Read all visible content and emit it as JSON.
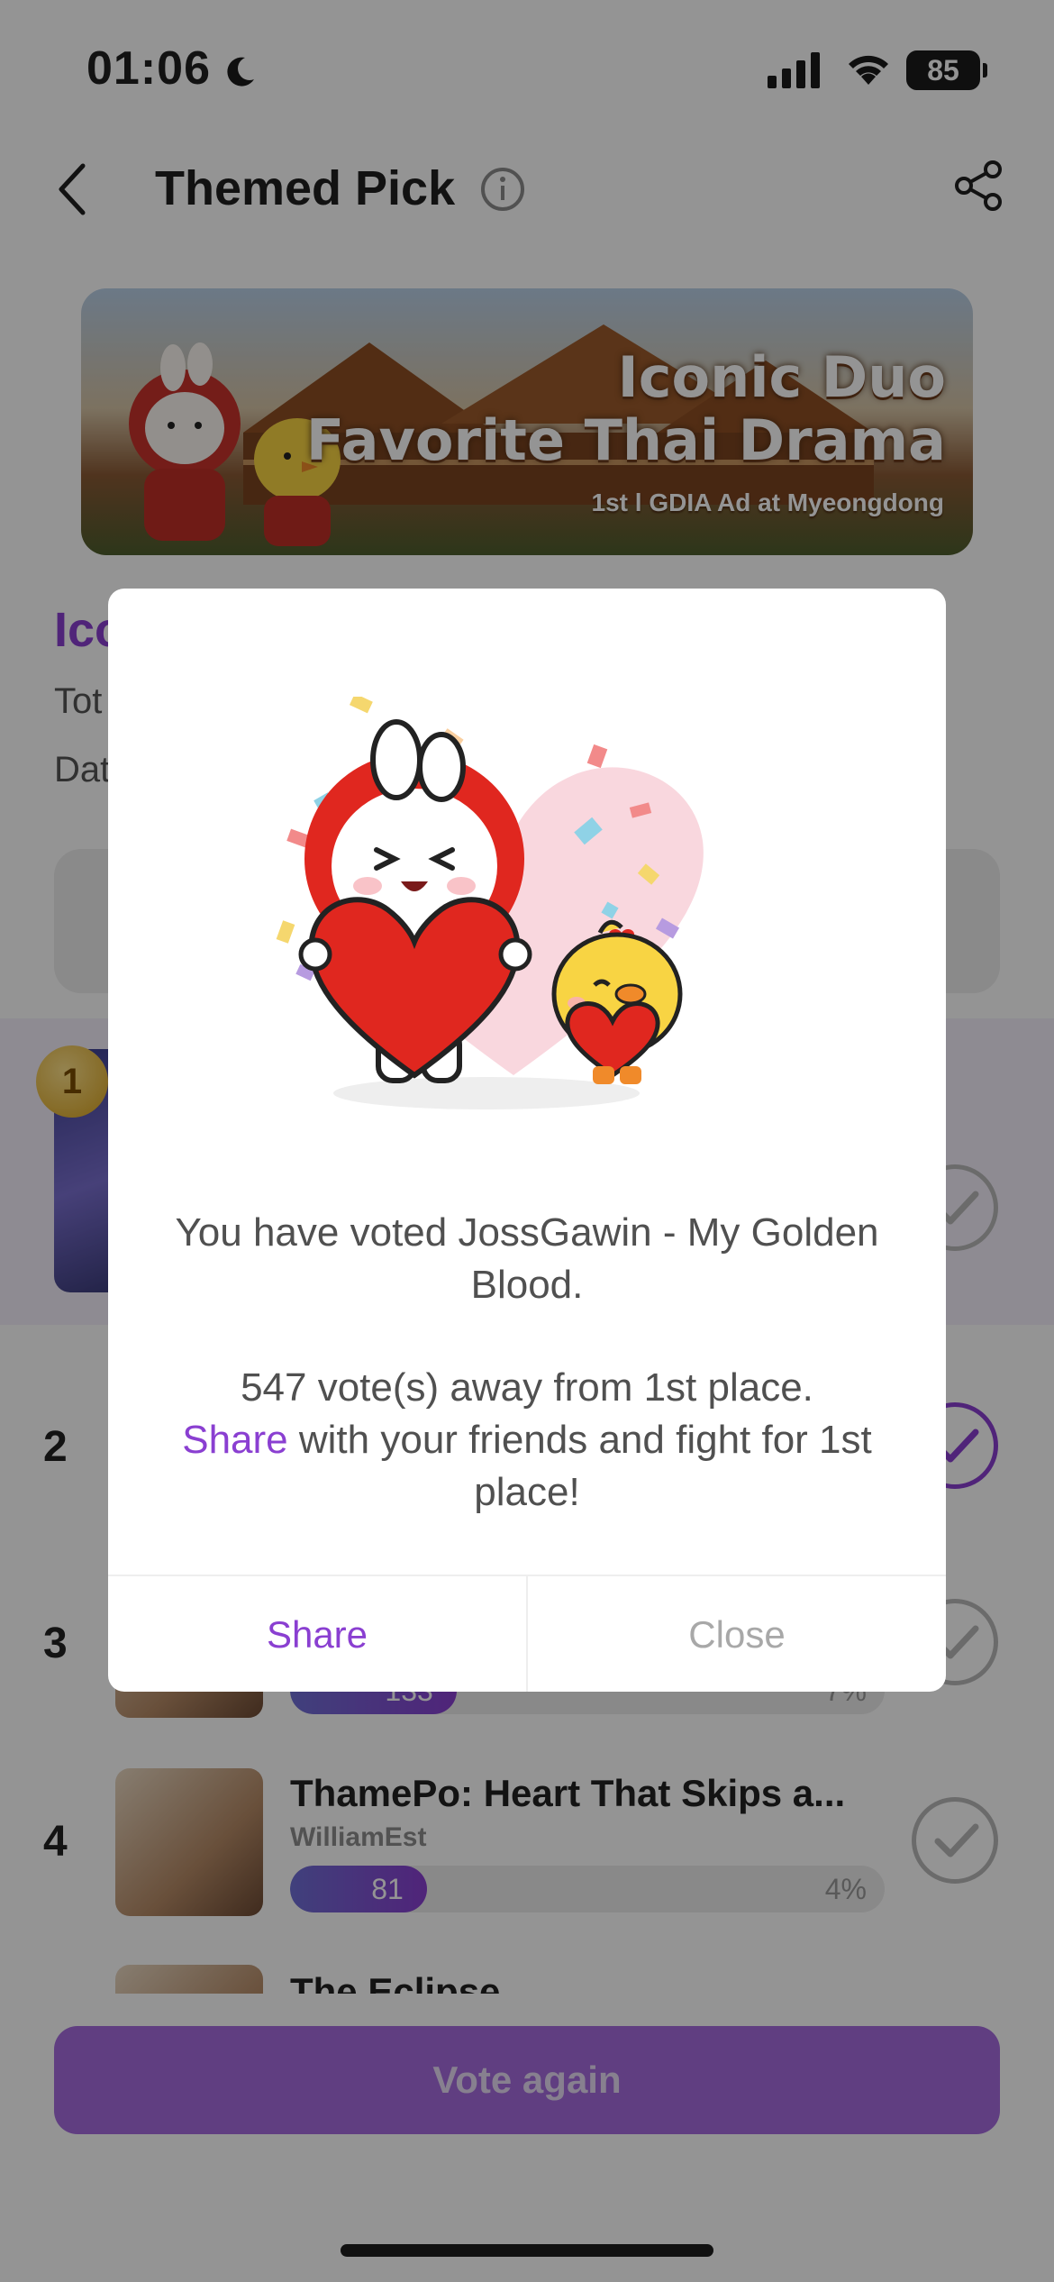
{
  "status_bar": {
    "time": "01:06",
    "battery": "85"
  },
  "header": {
    "title": "Themed Pick"
  },
  "banner": {
    "line1": "Iconic Duo",
    "line2": "Favorite Thai Drama",
    "line3": "1st l GDIA Ad at Myeongdong"
  },
  "poll": {
    "title_visible": "Ico",
    "total_visible": "Tot",
    "date_visible": "Dat"
  },
  "ranking": {
    "rank1_medal": "1",
    "items": [
      {
        "rank": "2"
      },
      {
        "rank": "3",
        "votes": "133",
        "percent": "7%",
        "fill_percent": 28
      },
      {
        "rank": "4",
        "title": "ThamePo: Heart That Skips a...",
        "artist": "WilliamEst",
        "votes": "81",
        "percent": "4%",
        "fill_percent": 23
      },
      {
        "title": "The Eclipse"
      }
    ]
  },
  "bottom": {
    "vote_again": "Vote again"
  },
  "modal": {
    "message": "You have voted JossGawin - My Golden Blood.",
    "away": "547 vote(s) away from 1st place.",
    "share_link": "Share",
    "away_rest": " with your friends and fight for 1st place!",
    "share_button": "Share",
    "close_button": "Close"
  },
  "colors": {
    "accent": "#8a3fd1",
    "vote_again_bg": "#a56cdf",
    "bar_fill_start": "#6f6fd6",
    "heart_red": "#e0271f"
  }
}
